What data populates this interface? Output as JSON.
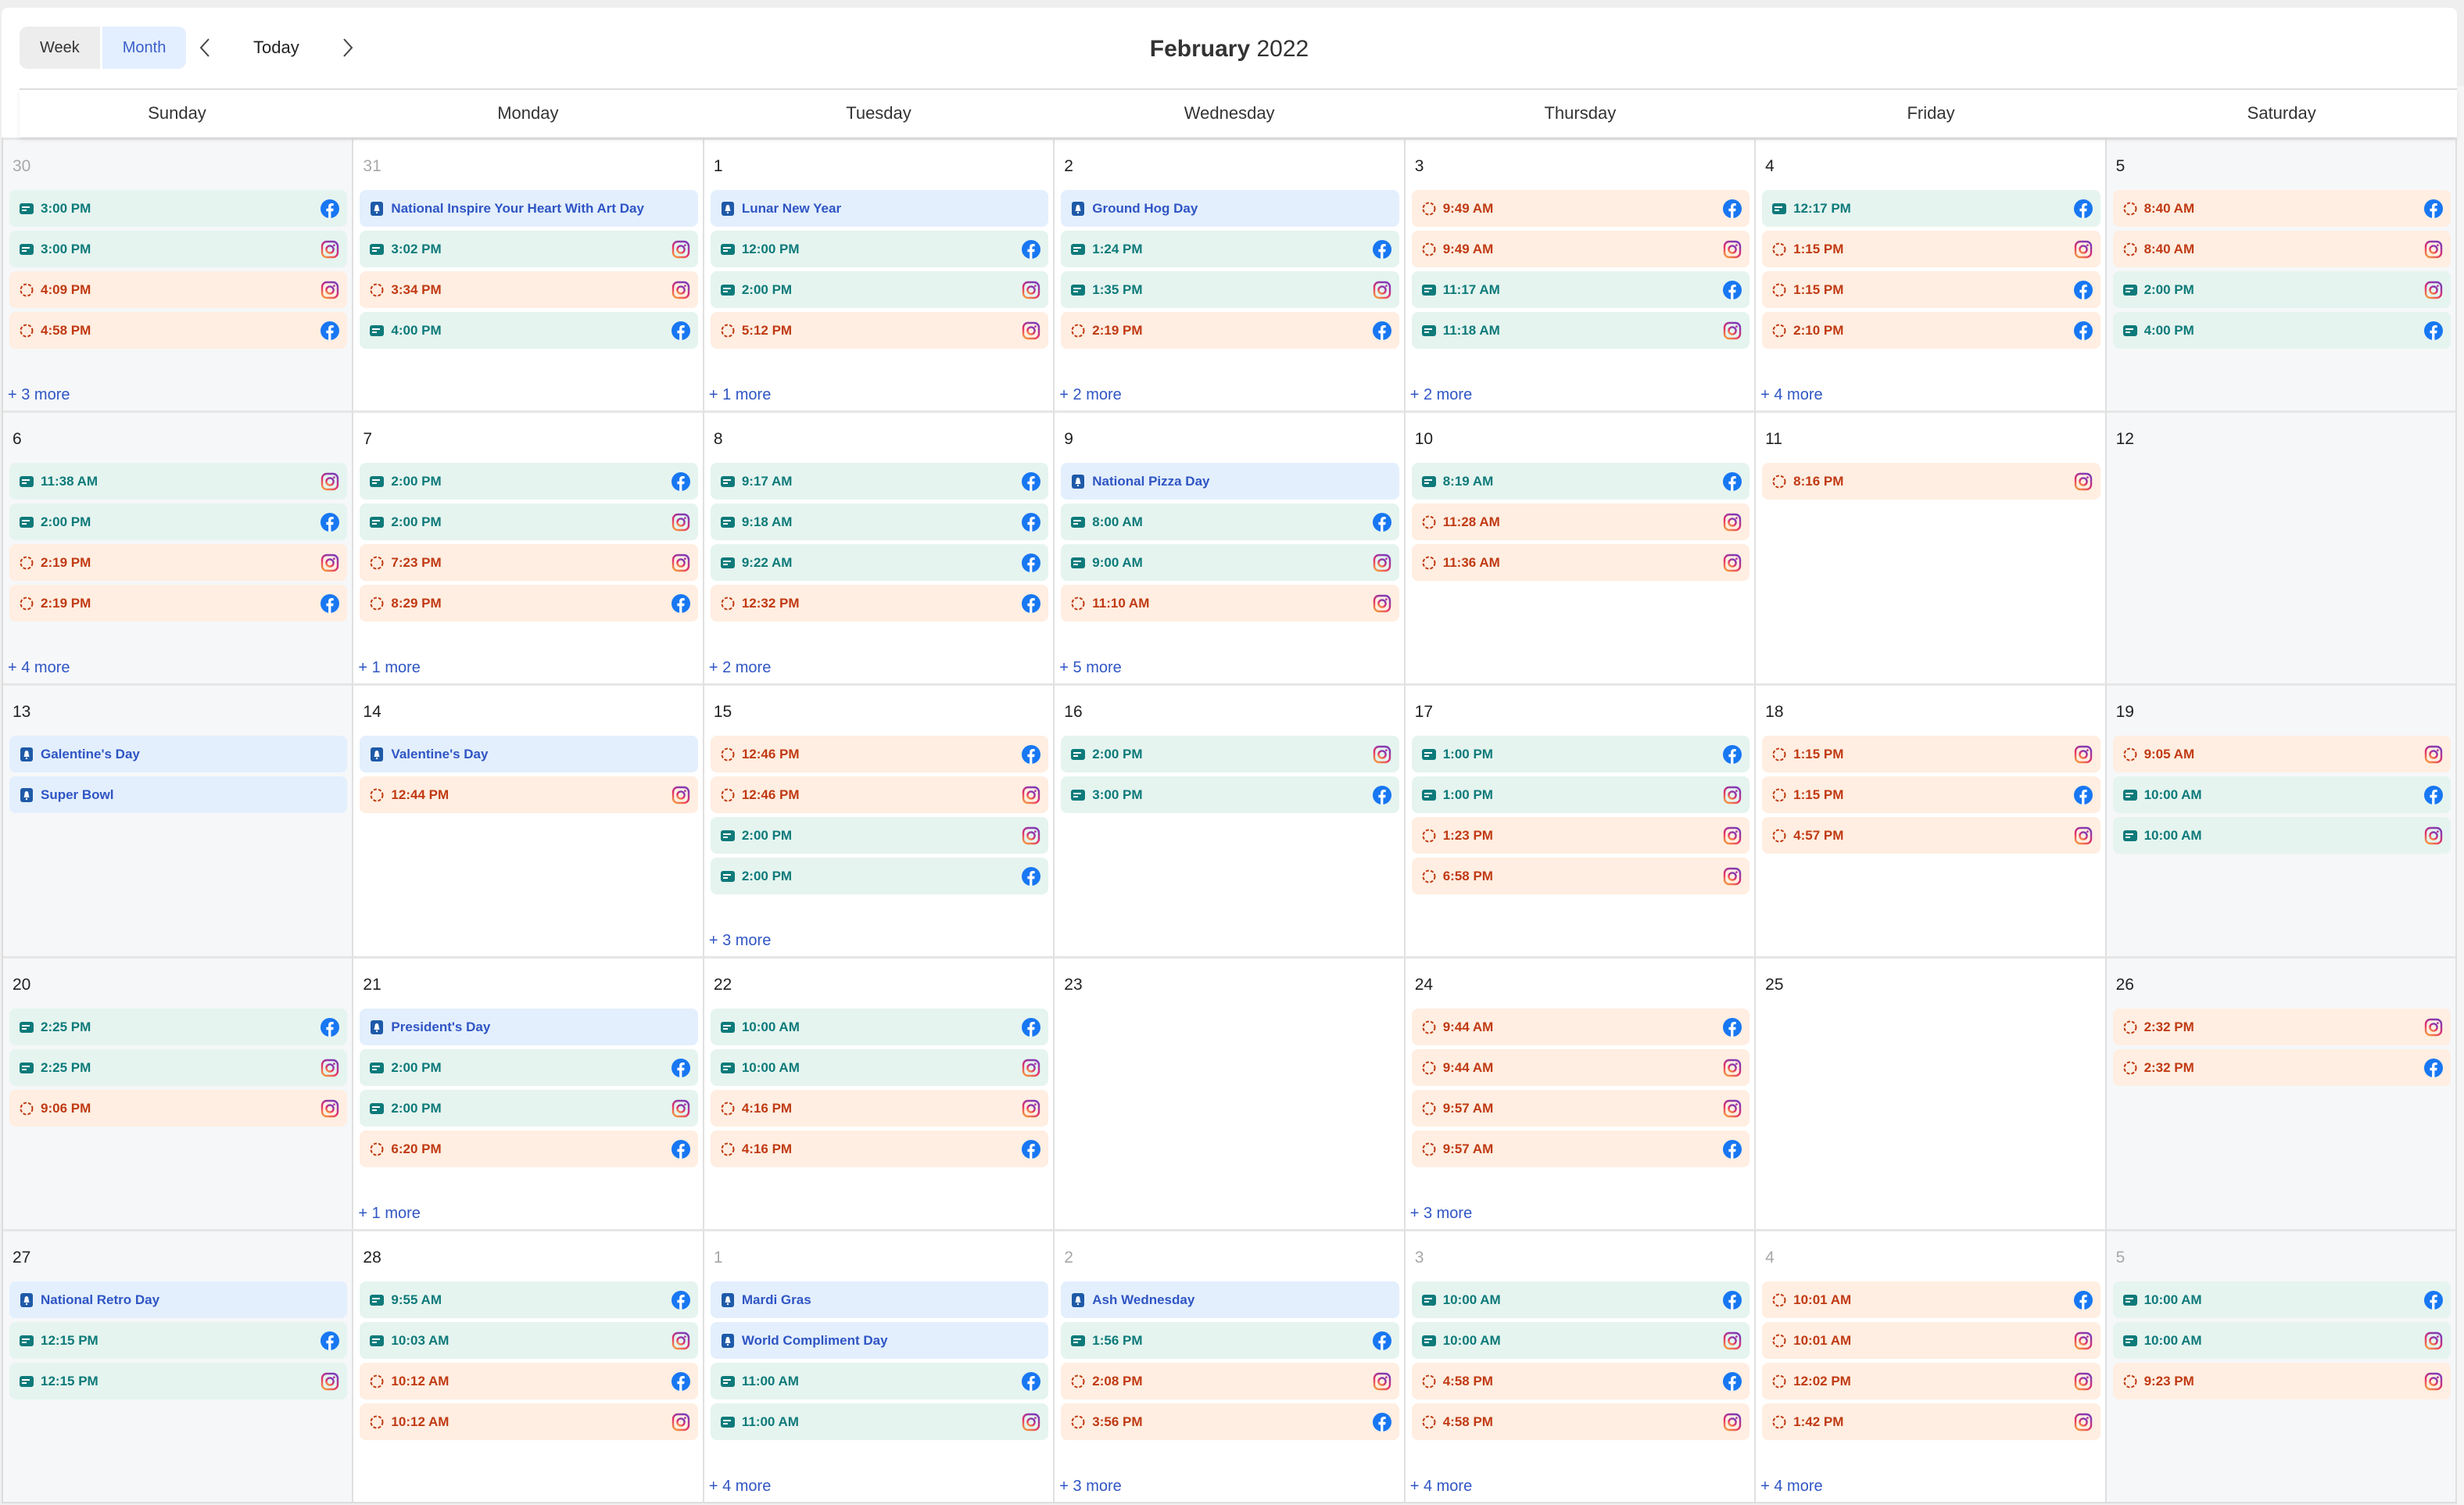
{
  "toolbar": {
    "views": [
      {
        "label": "Week",
        "active": false
      },
      {
        "label": "Month",
        "active": true
      }
    ],
    "today_label": "Today",
    "prev_icon": "chevron-left-icon",
    "next_icon": "chevron-right-icon",
    "title_month": "February",
    "title_year": "2022"
  },
  "weekdays": [
    "Sunday",
    "Monday",
    "Tuesday",
    "Wednesday",
    "Thursday",
    "Friday",
    "Saturday"
  ],
  "legend": {
    "published": {
      "icon": "post-card-icon",
      "bg": "#e5f4ef",
      "color": "#0e7a7a"
    },
    "pending": {
      "icon": "dashed-circle-icon",
      "bg": "#ffeee1",
      "color": "#c03a14"
    },
    "holiday": {
      "icon": "holiday-badge-icon",
      "bg": "#e3effd",
      "color": "#2f55c4"
    },
    "facebook": {
      "icon": "facebook-icon",
      "color": "#1877f2"
    },
    "instagram": {
      "icon": "instagram-icon"
    }
  },
  "weeks": [
    [
      {
        "day": "30",
        "other": true,
        "weekend": true,
        "more": "+ 3 more",
        "events": [
          {
            "type": "published",
            "label": "3:00 PM",
            "network": "facebook"
          },
          {
            "type": "published",
            "label": "3:00 PM",
            "network": "instagram"
          },
          {
            "type": "pending",
            "label": "4:09 PM",
            "network": "instagram"
          },
          {
            "type": "pending",
            "label": "4:58 PM",
            "network": "facebook"
          }
        ]
      },
      {
        "day": "31",
        "other": true,
        "weekend": false,
        "more": "",
        "events": [
          {
            "type": "holiday",
            "label": "National Inspire Your Heart With Art Day"
          },
          {
            "type": "published",
            "label": "3:02 PM",
            "network": "instagram"
          },
          {
            "type": "pending",
            "label": "3:34 PM",
            "network": "instagram"
          },
          {
            "type": "published",
            "label": "4:00 PM",
            "network": "facebook"
          }
        ]
      },
      {
        "day": "1",
        "other": false,
        "weekend": false,
        "more": "+ 1 more",
        "events": [
          {
            "type": "holiday",
            "label": "Lunar New Year"
          },
          {
            "type": "published",
            "label": "12:00 PM",
            "network": "facebook"
          },
          {
            "type": "published",
            "label": "2:00 PM",
            "network": "instagram"
          },
          {
            "type": "pending",
            "label": "5:12 PM",
            "network": "instagram"
          }
        ]
      },
      {
        "day": "2",
        "other": false,
        "weekend": false,
        "more": "+ 2 more",
        "events": [
          {
            "type": "holiday",
            "label": "Ground Hog Day"
          },
          {
            "type": "published",
            "label": "1:24 PM",
            "network": "facebook"
          },
          {
            "type": "published",
            "label": "1:35 PM",
            "network": "instagram"
          },
          {
            "type": "pending",
            "label": "2:19 PM",
            "network": "facebook"
          }
        ]
      },
      {
        "day": "3",
        "other": false,
        "weekend": false,
        "more": "+ 2 more",
        "events": [
          {
            "type": "pending",
            "label": "9:49 AM",
            "network": "facebook"
          },
          {
            "type": "pending",
            "label": "9:49 AM",
            "network": "instagram"
          },
          {
            "type": "published",
            "label": "11:17 AM",
            "network": "facebook"
          },
          {
            "type": "published",
            "label": "11:18 AM",
            "network": "instagram"
          }
        ]
      },
      {
        "day": "4",
        "other": false,
        "weekend": false,
        "more": "+ 4 more",
        "events": [
          {
            "type": "published",
            "label": "12:17 PM",
            "network": "facebook"
          },
          {
            "type": "pending",
            "label": "1:15 PM",
            "network": "instagram"
          },
          {
            "type": "pending",
            "label": "1:15 PM",
            "network": "facebook"
          },
          {
            "type": "pending",
            "label": "2:10 PM",
            "network": "facebook"
          }
        ]
      },
      {
        "day": "5",
        "other": false,
        "weekend": true,
        "more": "",
        "events": [
          {
            "type": "pending",
            "label": "8:40 AM",
            "network": "facebook"
          },
          {
            "type": "pending",
            "label": "8:40 AM",
            "network": "instagram"
          },
          {
            "type": "published",
            "label": "2:00 PM",
            "network": "instagram"
          },
          {
            "type": "published",
            "label": "4:00 PM",
            "network": "facebook"
          }
        ]
      }
    ],
    [
      {
        "day": "6",
        "other": false,
        "weekend": true,
        "more": "+ 4 more",
        "events": [
          {
            "type": "published",
            "label": "11:38 AM",
            "network": "instagram"
          },
          {
            "type": "published",
            "label": "2:00 PM",
            "network": "facebook"
          },
          {
            "type": "pending",
            "label": "2:19 PM",
            "network": "instagram"
          },
          {
            "type": "pending",
            "label": "2:19 PM",
            "network": "facebook"
          }
        ]
      },
      {
        "day": "7",
        "other": false,
        "weekend": false,
        "more": "+ 1 more",
        "events": [
          {
            "type": "published",
            "label": "2:00 PM",
            "network": "facebook"
          },
          {
            "type": "published",
            "label": "2:00 PM",
            "network": "instagram"
          },
          {
            "type": "pending",
            "label": "7:23 PM",
            "network": "instagram"
          },
          {
            "type": "pending",
            "label": "8:29 PM",
            "network": "facebook"
          }
        ]
      },
      {
        "day": "8",
        "other": false,
        "weekend": false,
        "more": "+ 2 more",
        "events": [
          {
            "type": "published",
            "label": "9:17 AM",
            "network": "facebook"
          },
          {
            "type": "published",
            "label": "9:18 AM",
            "network": "facebook"
          },
          {
            "type": "published",
            "label": "9:22 AM",
            "network": "facebook"
          },
          {
            "type": "pending",
            "label": "12:32 PM",
            "network": "facebook"
          }
        ]
      },
      {
        "day": "9",
        "other": false,
        "weekend": false,
        "more": "+ 5 more",
        "events": [
          {
            "type": "holiday",
            "label": "National Pizza Day"
          },
          {
            "type": "published",
            "label": "8:00 AM",
            "network": "facebook"
          },
          {
            "type": "published",
            "label": "9:00 AM",
            "network": "instagram"
          },
          {
            "type": "pending",
            "label": "11:10 AM",
            "network": "instagram"
          }
        ]
      },
      {
        "day": "10",
        "other": false,
        "weekend": false,
        "more": "",
        "events": [
          {
            "type": "published",
            "label": "8:19 AM",
            "network": "facebook"
          },
          {
            "type": "pending",
            "label": "11:28 AM",
            "network": "instagram"
          },
          {
            "type": "pending",
            "label": "11:36 AM",
            "network": "instagram"
          }
        ]
      },
      {
        "day": "11",
        "other": false,
        "weekend": false,
        "more": "",
        "events": [
          {
            "type": "pending",
            "label": "8:16 PM",
            "network": "instagram"
          }
        ]
      },
      {
        "day": "12",
        "other": false,
        "weekend": true,
        "more": "",
        "events": []
      }
    ],
    [
      {
        "day": "13",
        "other": false,
        "weekend": true,
        "more": "",
        "events": [
          {
            "type": "holiday",
            "label": "Galentine's Day"
          },
          {
            "type": "holiday",
            "label": "Super Bowl"
          }
        ]
      },
      {
        "day": "14",
        "other": false,
        "weekend": false,
        "more": "",
        "events": [
          {
            "type": "holiday",
            "label": "Valentine's Day"
          },
          {
            "type": "pending",
            "label": "12:44 PM",
            "network": "instagram"
          }
        ]
      },
      {
        "day": "15",
        "other": false,
        "weekend": false,
        "more": "+ 3 more",
        "events": [
          {
            "type": "pending",
            "label": "12:46 PM",
            "network": "facebook"
          },
          {
            "type": "pending",
            "label": "12:46 PM",
            "network": "instagram"
          },
          {
            "type": "published",
            "label": "2:00 PM",
            "network": "instagram"
          },
          {
            "type": "published",
            "label": "2:00 PM",
            "network": "facebook"
          }
        ]
      },
      {
        "day": "16",
        "other": false,
        "weekend": false,
        "more": "",
        "events": [
          {
            "type": "published",
            "label": "2:00 PM",
            "network": "instagram"
          },
          {
            "type": "published",
            "label": "3:00 PM",
            "network": "facebook"
          }
        ]
      },
      {
        "day": "17",
        "other": false,
        "weekend": false,
        "more": "",
        "events": [
          {
            "type": "published",
            "label": "1:00 PM",
            "network": "facebook"
          },
          {
            "type": "published",
            "label": "1:00 PM",
            "network": "instagram"
          },
          {
            "type": "pending",
            "label": "1:23 PM",
            "network": "instagram"
          },
          {
            "type": "pending",
            "label": "6:58 PM",
            "network": "instagram"
          }
        ]
      },
      {
        "day": "18",
        "other": false,
        "weekend": false,
        "more": "",
        "events": [
          {
            "type": "pending",
            "label": "1:15 PM",
            "network": "instagram"
          },
          {
            "type": "pending",
            "label": "1:15 PM",
            "network": "facebook"
          },
          {
            "type": "pending",
            "label": "4:57 PM",
            "network": "instagram"
          }
        ]
      },
      {
        "day": "19",
        "other": false,
        "weekend": true,
        "more": "",
        "events": [
          {
            "type": "pending",
            "label": "9:05 AM",
            "network": "instagram"
          },
          {
            "type": "published",
            "label": "10:00 AM",
            "network": "facebook"
          },
          {
            "type": "published",
            "label": "10:00 AM",
            "network": "instagram"
          }
        ]
      }
    ],
    [
      {
        "day": "20",
        "other": false,
        "weekend": true,
        "more": "",
        "events": [
          {
            "type": "published",
            "label": "2:25 PM",
            "network": "facebook"
          },
          {
            "type": "published",
            "label": "2:25 PM",
            "network": "instagram"
          },
          {
            "type": "pending",
            "label": "9:06 PM",
            "network": "instagram"
          }
        ]
      },
      {
        "day": "21",
        "other": false,
        "weekend": false,
        "more": "+ 1 more",
        "events": [
          {
            "type": "holiday",
            "label": "President's Day"
          },
          {
            "type": "published",
            "label": "2:00 PM",
            "network": "facebook"
          },
          {
            "type": "published",
            "label": "2:00 PM",
            "network": "instagram"
          },
          {
            "type": "pending",
            "label": "6:20 PM",
            "network": "facebook"
          }
        ]
      },
      {
        "day": "22",
        "other": false,
        "weekend": false,
        "more": "",
        "events": [
          {
            "type": "published",
            "label": "10:00 AM",
            "network": "facebook"
          },
          {
            "type": "published",
            "label": "10:00 AM",
            "network": "instagram"
          },
          {
            "type": "pending",
            "label": "4:16 PM",
            "network": "instagram"
          },
          {
            "type": "pending",
            "label": "4:16 PM",
            "network": "facebook"
          }
        ]
      },
      {
        "day": "23",
        "other": false,
        "weekend": false,
        "more": "",
        "events": []
      },
      {
        "day": "24",
        "other": false,
        "weekend": false,
        "more": "+ 3 more",
        "events": [
          {
            "type": "pending",
            "label": "9:44 AM",
            "network": "facebook"
          },
          {
            "type": "pending",
            "label": "9:44 AM",
            "network": "instagram"
          },
          {
            "type": "pending",
            "label": "9:57 AM",
            "network": "instagram"
          },
          {
            "type": "pending",
            "label": "9:57 AM",
            "network": "facebook"
          }
        ]
      },
      {
        "day": "25",
        "other": false,
        "weekend": false,
        "more": "",
        "events": []
      },
      {
        "day": "26",
        "other": false,
        "weekend": true,
        "more": "",
        "events": [
          {
            "type": "pending",
            "label": "2:32 PM",
            "network": "instagram"
          },
          {
            "type": "pending",
            "label": "2:32 PM",
            "network": "facebook"
          }
        ]
      }
    ],
    [
      {
        "day": "27",
        "other": false,
        "weekend": true,
        "more": "",
        "events": [
          {
            "type": "holiday",
            "label": "National Retro Day"
          },
          {
            "type": "published",
            "label": "12:15 PM",
            "network": "facebook"
          },
          {
            "type": "published",
            "label": "12:15 PM",
            "network": "instagram"
          }
        ]
      },
      {
        "day": "28",
        "other": false,
        "weekend": false,
        "more": "",
        "events": [
          {
            "type": "published",
            "label": "9:55 AM",
            "network": "facebook"
          },
          {
            "type": "published",
            "label": "10:03 AM",
            "network": "instagram"
          },
          {
            "type": "pending",
            "label": "10:12 AM",
            "network": "facebook"
          },
          {
            "type": "pending",
            "label": "10:12 AM",
            "network": "instagram"
          }
        ]
      },
      {
        "day": "1",
        "other": true,
        "weekend": false,
        "more": "+ 4 more",
        "events": [
          {
            "type": "holiday",
            "label": "Mardi Gras"
          },
          {
            "type": "holiday",
            "label": "World Compliment Day"
          },
          {
            "type": "published",
            "label": "11:00 AM",
            "network": "facebook"
          },
          {
            "type": "published",
            "label": "11:00 AM",
            "network": "instagram"
          }
        ]
      },
      {
        "day": "2",
        "other": true,
        "weekend": false,
        "more": "+ 3 more",
        "events": [
          {
            "type": "holiday",
            "label": "Ash Wednesday"
          },
          {
            "type": "published",
            "label": "1:56 PM",
            "network": "facebook"
          },
          {
            "type": "pending",
            "label": "2:08 PM",
            "network": "instagram"
          },
          {
            "type": "pending",
            "label": "3:56 PM",
            "network": "facebook"
          }
        ]
      },
      {
        "day": "3",
        "other": true,
        "weekend": false,
        "more": "+ 4 more",
        "events": [
          {
            "type": "published",
            "label": "10:00 AM",
            "network": "facebook"
          },
          {
            "type": "published",
            "label": "10:00 AM",
            "network": "instagram"
          },
          {
            "type": "pending",
            "label": "4:58 PM",
            "network": "facebook"
          },
          {
            "type": "pending",
            "label": "4:58 PM",
            "network": "instagram"
          }
        ]
      },
      {
        "day": "4",
        "other": true,
        "weekend": false,
        "more": "+ 4 more",
        "events": [
          {
            "type": "pending",
            "label": "10:01 AM",
            "network": "facebook"
          },
          {
            "type": "pending",
            "label": "10:01 AM",
            "network": "instagram"
          },
          {
            "type": "pending",
            "label": "12:02 PM",
            "network": "instagram"
          },
          {
            "type": "pending",
            "label": "1:42 PM",
            "network": "instagram"
          }
        ]
      },
      {
        "day": "5",
        "other": true,
        "weekend": true,
        "more": "",
        "events": [
          {
            "type": "published",
            "label": "10:00 AM",
            "network": "facebook"
          },
          {
            "type": "published",
            "label": "10:00 AM",
            "network": "instagram"
          },
          {
            "type": "pending",
            "label": "9:23 PM",
            "network": "instagram"
          }
        ]
      }
    ]
  ]
}
